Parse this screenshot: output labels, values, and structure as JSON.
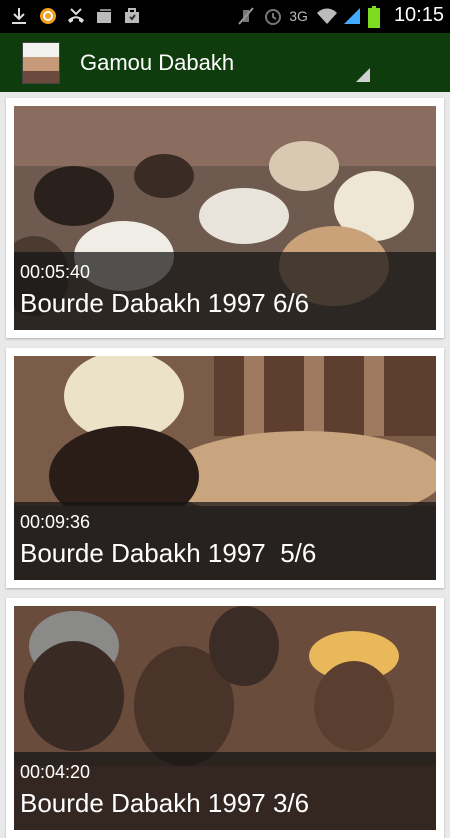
{
  "status_bar": {
    "time": "10:15",
    "network": "3G",
    "left_icons": [
      "download-icon",
      "q-app-icon",
      "missed-call-icon",
      "photos-icon",
      "bag-icon"
    ],
    "right_icons": [
      "mute-icon",
      "alarm-icon",
      "wifi-icon",
      "signal-icon",
      "battery-icon"
    ]
  },
  "action_bar": {
    "title": "Gamou Dabakh",
    "icon": "portrait-icon"
  },
  "videos": [
    {
      "duration": "00:05:40",
      "title": "Bourde Dabakh 1997 6/6"
    },
    {
      "duration": "00:09:36",
      "title": "Bourde Dabakh 1997  5/6"
    },
    {
      "duration": "00:04:20",
      "title": "Bourde Dabakh 1997 3/6"
    }
  ],
  "colors": {
    "action_bar": "#0f3c0c",
    "status_bar": "#000000",
    "battery": "#7ddc1f",
    "background": "#e9e9e9"
  }
}
